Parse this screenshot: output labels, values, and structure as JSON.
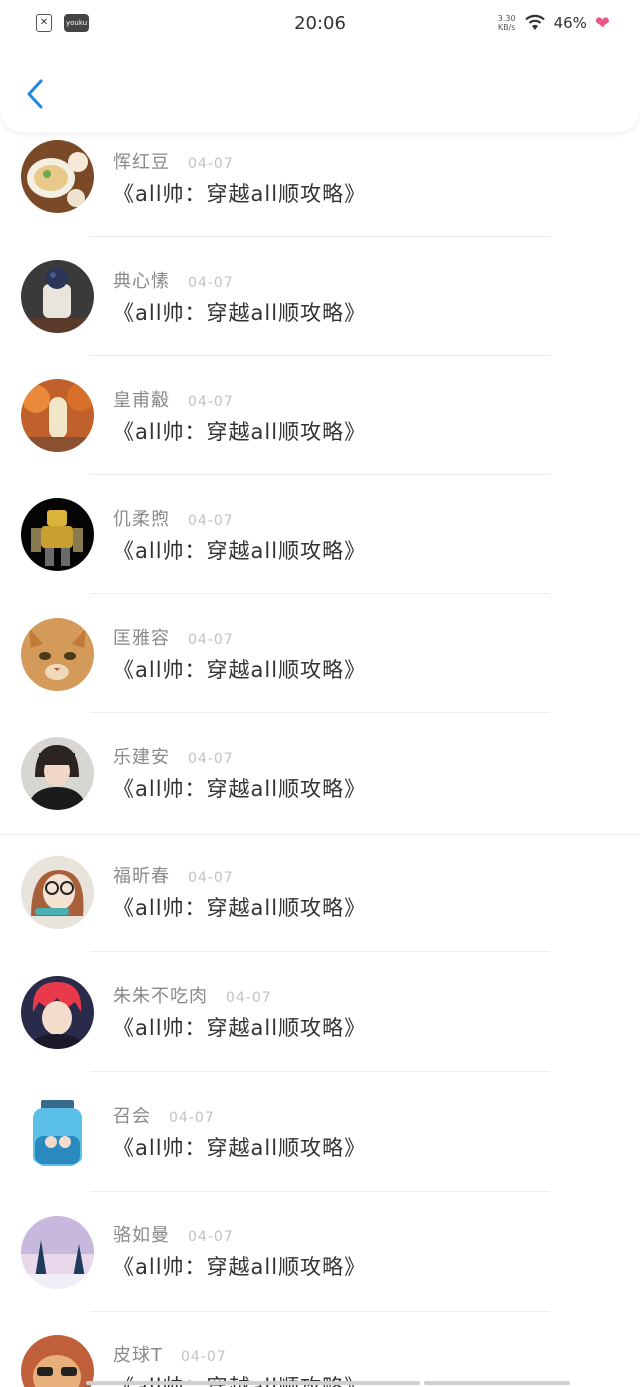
{
  "status_bar": {
    "time": "20:06",
    "net_speed_value": "3.30",
    "net_speed_unit": "KB/s",
    "battery": "46%",
    "left_icons": [
      "sim-icon",
      "youku-icon"
    ],
    "youku_label": "youku"
  },
  "header": {
    "back_icon": "chevron-left-icon",
    "accent": "#1e88e5"
  },
  "comments": [
    {
      "name": "恽红豆",
      "date": "04-07",
      "text": "《all帅：穿越all顺攻略》"
    },
    {
      "name": "典心愫",
      "date": "04-07",
      "text": "《all帅：穿越all顺攻略》"
    },
    {
      "name": "皇甫觳",
      "date": "04-07",
      "text": "《all帅：穿越all顺攻略》"
    },
    {
      "name": "仉柔煦",
      "date": "04-07",
      "text": "《all帅：穿越all顺攻略》"
    },
    {
      "name": "匡雅容",
      "date": "04-07",
      "text": "《all帅：穿越all顺攻略》"
    },
    {
      "name": "乐建安",
      "date": "04-07",
      "text": "《all帅：穿越all顺攻略》"
    },
    {
      "name": "福昕春",
      "date": "04-07",
      "text": "《all帅：穿越all顺攻略》"
    },
    {
      "name": "朱朱不吃肉",
      "date": "04-07",
      "text": "《all帅：穿越all顺攻略》"
    },
    {
      "name": "召会",
      "date": "04-07",
      "text": "《all帅：穿越all顺攻略》"
    },
    {
      "name": "骆如曼",
      "date": "04-07",
      "text": "《all帅：穿越all顺攻略》"
    },
    {
      "name": "皮球T",
      "date": "04-07",
      "text": "《all帅：穿越all顺攻略》"
    }
  ]
}
